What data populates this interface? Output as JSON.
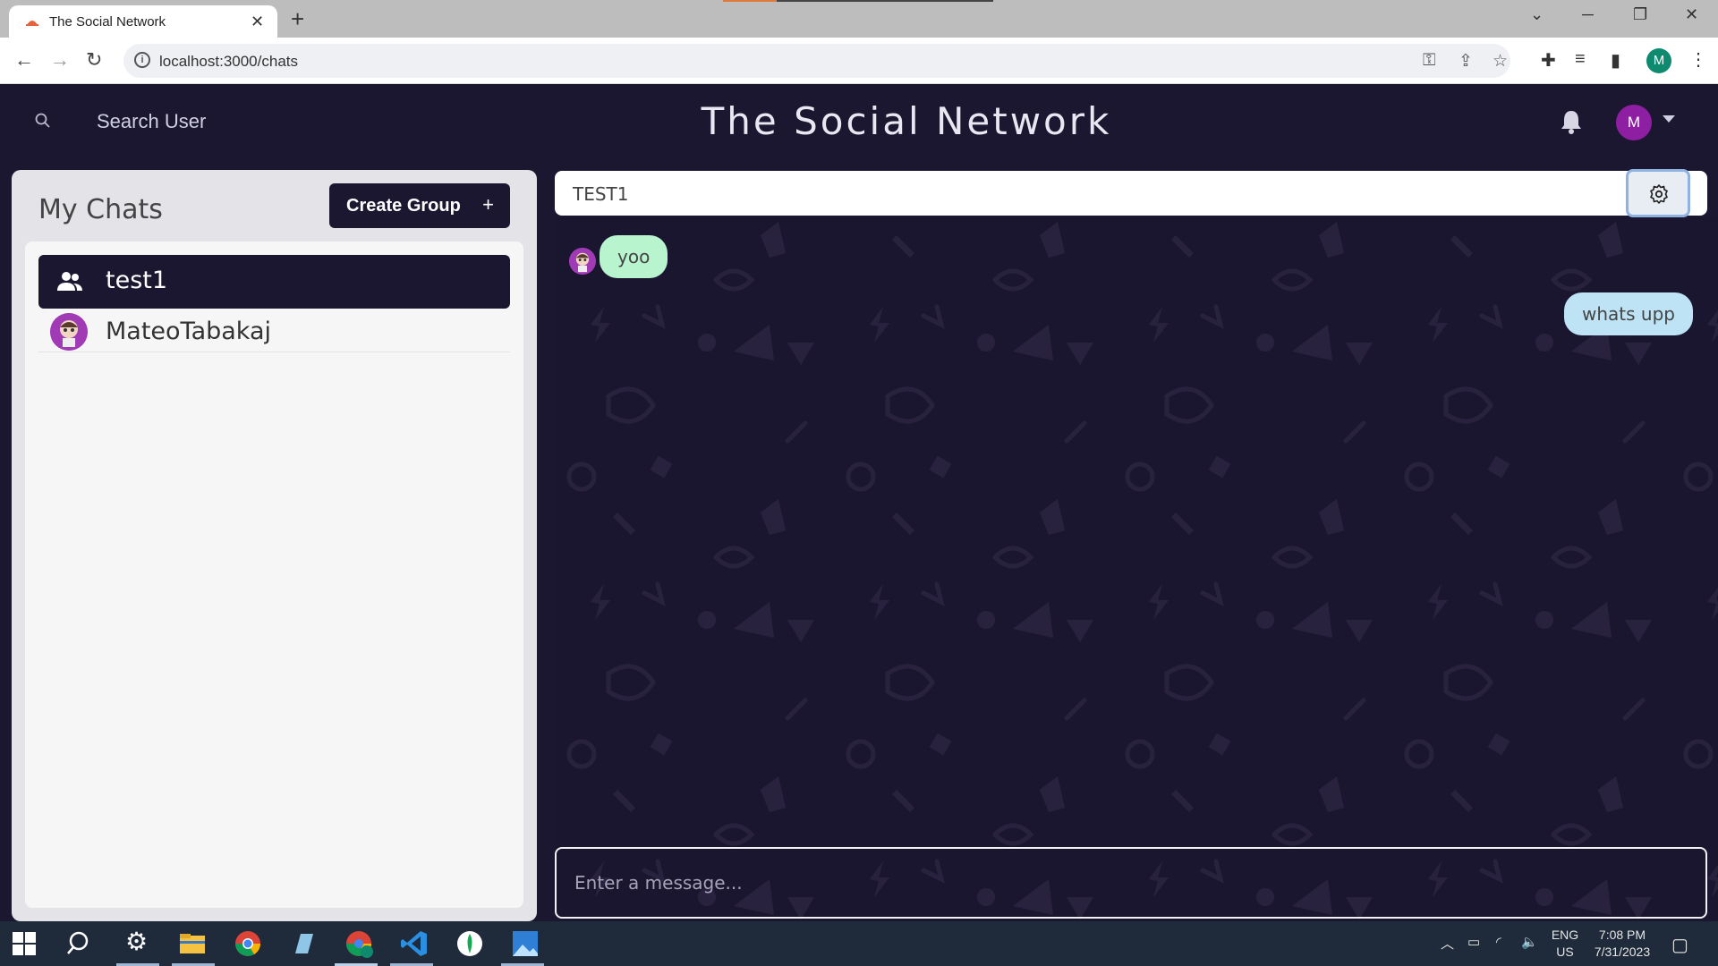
{
  "browser": {
    "tab_title": "The Social Network",
    "url": "localhost:3000/chats",
    "profile_initial": "M",
    "tab_close": "✕",
    "new_tab": "+"
  },
  "app": {
    "search_label": "Search User",
    "brand_title": "The Social Network",
    "user_initial": "M"
  },
  "sidebar": {
    "title": "My Chats",
    "create_group_label": "Create Group",
    "create_group_plus": "+",
    "chats": [
      {
        "name": "test1",
        "type": "group",
        "active": true
      },
      {
        "name": "MateoTabakaj",
        "type": "direct",
        "active": false
      }
    ]
  },
  "chat": {
    "header_name": "TEST1",
    "messages": [
      {
        "text": "yoo",
        "direction": "incoming"
      },
      {
        "text": "whats upp",
        "direction": "outgoing"
      }
    ],
    "composer_placeholder": "Enter a message..."
  },
  "taskbar": {
    "lang_top": "ENG",
    "lang_bottom": "US",
    "time": "7:08 PM",
    "date": "7/31/2023"
  },
  "colors": {
    "app_background": "#1c1731",
    "incoming_bubble": "#b8f5cf",
    "outgoing_bubble": "#bde3f5",
    "avatar": "#8e1fa2"
  },
  "icons": [
    "search-icon",
    "bell-icon",
    "gear-icon",
    "group-icon",
    "plus-icon",
    "chevron-down-icon"
  ]
}
